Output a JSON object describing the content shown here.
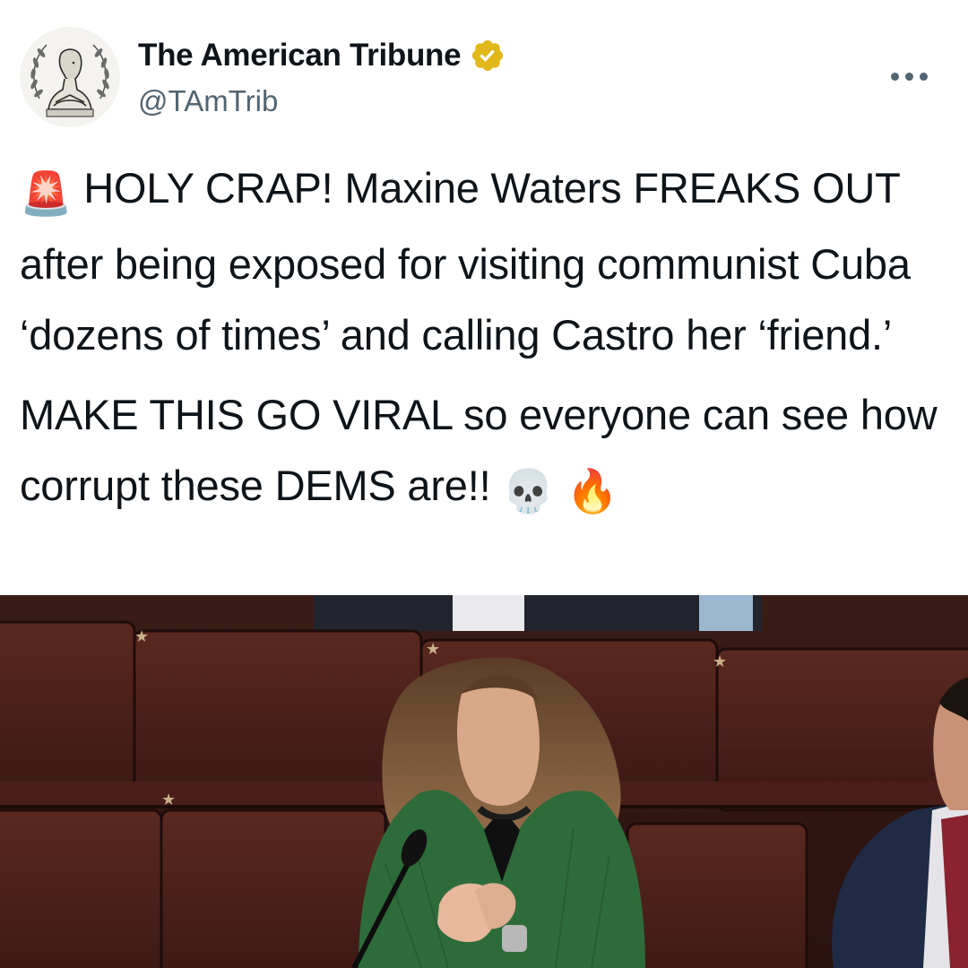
{
  "account": {
    "display_name": "The American Tribune",
    "handle": "@TAmTrib",
    "verified": true,
    "verified_badge_color": "#e2b719",
    "avatar_icon": "classical-bust-laurel-wreath-logo"
  },
  "menu": {
    "more_icon": "more-horizontal-icon"
  },
  "tweet": {
    "paragraph_1": {
      "emoji_lead": "🚨",
      "text": "HOLY CRAP! Maxine Waters FREAKS OUT after being exposed for visiting communist Cuba ‘dozens of times’ and calling Castro her ‘friend.’"
    },
    "paragraph_2": {
      "text": "MAKE THIS GO VIRAL so everyone can see how corrupt these DEMS are!!",
      "emoji_skull": "💀",
      "emoji_fire": "🔥"
    }
  },
  "media": {
    "type": "photo",
    "colors": {
      "seat_leather": "#4a1f1a",
      "jacket": "#2e6b3a",
      "hair": "#7a5537"
    }
  }
}
